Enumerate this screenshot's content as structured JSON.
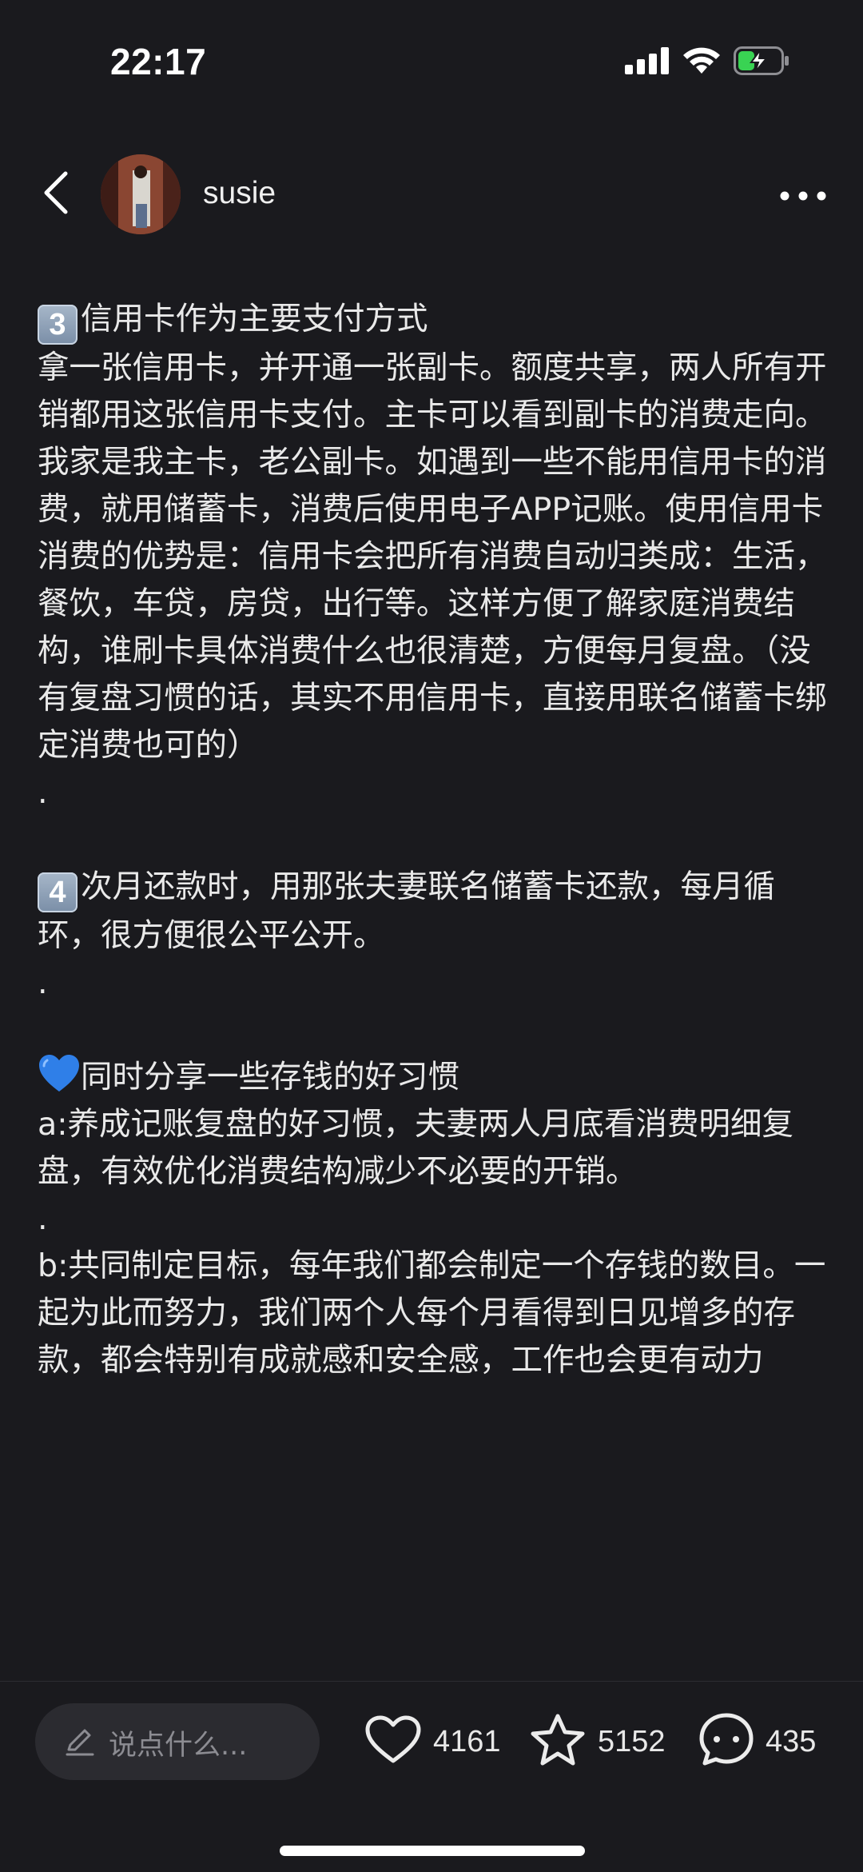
{
  "status_bar": {
    "time": "22:17",
    "icons": [
      "cellular-signal-icon",
      "wifi-icon",
      "battery-charging-icon"
    ]
  },
  "header": {
    "author_name": "susie",
    "icons": [
      "back-icon",
      "more-icon"
    ]
  },
  "content": {
    "paragraphs": [
      {
        "prefix_keycap": "3",
        "text": "信用卡作为主要支付方式\n拿一张信用卡，并开通一张副卡。额度共享，两人所有开销都用这张信用卡支付。主卡可以看到副卡的消费走向。我家是我主卡，老公副卡。如遇到一些不能用信用卡的消费，就用储蓄卡，消费后使用电子APP记账。使用信用卡消费的优势是：信用卡会把所有消费自动归类成：生活，餐饮，车贷，房贷，出行等。这样方便了解家庭消费结构，谁刷卡具体消费什么也很清楚，方便每月复盘。（没有复盘习惯的话，其实不用信用卡，直接用联名储蓄卡绑定消费也可的）"
      },
      {
        "text": "."
      },
      {
        "text": ""
      },
      {
        "prefix_keycap": "4",
        "text": "次月还款时，用那张夫妻联名储蓄卡还款，每月循环，很方便很公平公开。"
      },
      {
        "text": "."
      },
      {
        "text": ""
      },
      {
        "prefix_emoji": "blue-heart-emoji",
        "text": "同时分享一些存钱的好习惯"
      },
      {
        "text": "a:养成记账复盘的好习惯，夫妻两人月底看消费明细复盘，有效优化消费结构减少不必要的开销。"
      },
      {
        "text": "."
      },
      {
        "text": "b:共同制定目标，每年我们都会制定一个存钱的数目。一起为此而努力，我们两个人每个月看得到日见增多的存款，都会特别有成就感和安全感，工作也会更有动力"
      }
    ]
  },
  "bottom_bar": {
    "comment_placeholder": "说点什么...",
    "like_count": "4161",
    "favorite_count": "5152",
    "comment_count": "435",
    "icons": [
      "pencil-icon",
      "heart-outline-icon",
      "star-outline-icon",
      "chat-bubble-icon"
    ]
  },
  "colors": {
    "background": "#1a1a1e",
    "text": "#e9e9e9",
    "input_background": "#2b2b30"
  }
}
